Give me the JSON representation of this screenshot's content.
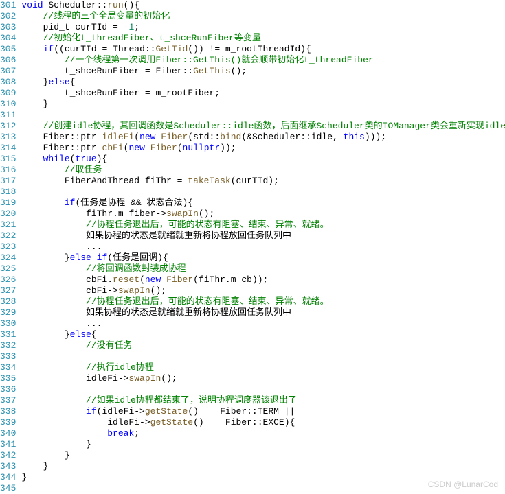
{
  "first_line": 301,
  "watermark": "CSDN @LunarCod",
  "lines": [
    [
      [
        "kw",
        "void"
      ],
      [
        "id",
        " Scheduler"
      ],
      [
        "op",
        "::"
      ],
      [
        "fn",
        "run"
      ],
      [
        "op",
        "(){"
      ]
    ],
    [
      [
        "id",
        "    "
      ],
      [
        "cmt",
        "//线程的三个全局变量的初始化"
      ]
    ],
    [
      [
        "id",
        "    pid_t curTId "
      ],
      [
        "op",
        "= "
      ],
      [
        "num",
        "-1"
      ],
      [
        "op",
        ";"
      ]
    ],
    [
      [
        "id",
        "    "
      ],
      [
        "cmt",
        "//初始化t_threadFiber、t_shceRunFiber等变量"
      ]
    ],
    [
      [
        "id",
        "    "
      ],
      [
        "kw",
        "if"
      ],
      [
        "op",
        "((curTId "
      ],
      [
        "op",
        "="
      ],
      [
        "id",
        " Thread"
      ],
      [
        "op",
        "::"
      ],
      [
        "fn",
        "GetTid"
      ],
      [
        "op",
        "()) "
      ],
      [
        "op",
        "!="
      ],
      [
        "id",
        " m_rootThreadId"
      ],
      [
        "op",
        "){"
      ]
    ],
    [
      [
        "id",
        "        "
      ],
      [
        "cmt",
        "//一个线程第一次调用Fiber::GetThis()就会顺带初始化t_threadFiber"
      ]
    ],
    [
      [
        "id",
        "        t_shceRunFiber "
      ],
      [
        "op",
        "="
      ],
      [
        "id",
        " Fiber"
      ],
      [
        "op",
        "::"
      ],
      [
        "fn",
        "GetThis"
      ],
      [
        "op",
        "();"
      ]
    ],
    [
      [
        "id",
        "    "
      ],
      [
        "op",
        "}"
      ],
      [
        "kw",
        "else"
      ],
      [
        "op",
        "{"
      ]
    ],
    [
      [
        "id",
        "        t_shceRunFiber "
      ],
      [
        "op",
        "="
      ],
      [
        "id",
        " m_rootFiber"
      ],
      [
        "op",
        ";"
      ]
    ],
    [
      [
        "id",
        "    "
      ],
      [
        "op",
        "}"
      ]
    ],
    [
      [
        "id",
        ""
      ]
    ],
    [
      [
        "id",
        "    "
      ],
      [
        "cmt",
        "//创建idle协程，其回调函数是Scheduler::idle函数，后面继承Scheduler类的IOManager类会重新实现idle函数"
      ]
    ],
    [
      [
        "id",
        "    Fiber"
      ],
      [
        "op",
        "::"
      ],
      [
        "id",
        "ptr "
      ],
      [
        "fn",
        "idleFi"
      ],
      [
        "op",
        "("
      ],
      [
        "kw",
        "new"
      ],
      [
        "id",
        " "
      ],
      [
        "fn",
        "Fiber"
      ],
      [
        "op",
        "(std"
      ],
      [
        "op",
        "::"
      ],
      [
        "fn",
        "bind"
      ],
      [
        "op",
        "("
      ],
      [
        "op",
        "&"
      ],
      [
        "id",
        "Scheduler"
      ],
      [
        "op",
        "::"
      ],
      [
        "id",
        "idle"
      ],
      [
        "op",
        ", "
      ],
      [
        "kw",
        "this"
      ],
      [
        "op",
        ")));"
      ]
    ],
    [
      [
        "id",
        "    Fiber"
      ],
      [
        "op",
        "::"
      ],
      [
        "id",
        "ptr "
      ],
      [
        "fn",
        "cbFi"
      ],
      [
        "op",
        "("
      ],
      [
        "kw",
        "new"
      ],
      [
        "id",
        " "
      ],
      [
        "fn",
        "Fiber"
      ],
      [
        "op",
        "("
      ],
      [
        "kw",
        "nullptr"
      ],
      [
        "op",
        "));"
      ]
    ],
    [
      [
        "id",
        "    "
      ],
      [
        "kw",
        "while"
      ],
      [
        "op",
        "("
      ],
      [
        "kw",
        "true"
      ],
      [
        "op",
        "){"
      ]
    ],
    [
      [
        "id",
        "        "
      ],
      [
        "cmt",
        "//取任务"
      ]
    ],
    [
      [
        "id",
        "        FiberAndThread fiThr "
      ],
      [
        "op",
        "="
      ],
      [
        "id",
        " "
      ],
      [
        "fn",
        "takeTask"
      ],
      [
        "op",
        "(curTId);"
      ]
    ],
    [
      [
        "id",
        ""
      ]
    ],
    [
      [
        "id",
        "        "
      ],
      [
        "kw",
        "if"
      ],
      [
        "op",
        "("
      ],
      [
        "id",
        "任务是协程 "
      ],
      [
        "op",
        "&&"
      ],
      [
        "id",
        " 状态合法"
      ],
      [
        "op",
        "){"
      ]
    ],
    [
      [
        "id",
        "            fiThr"
      ],
      [
        "op",
        "."
      ],
      [
        "id",
        "m_fiber"
      ],
      [
        "op",
        "->"
      ],
      [
        "fn",
        "swapIn"
      ],
      [
        "op",
        "();"
      ]
    ],
    [
      [
        "id",
        "            "
      ],
      [
        "cmt",
        "//协程任务退出后，可能的状态有阻塞、结束、异常、就绪。"
      ]
    ],
    [
      [
        "id",
        "            如果协程的状态是就绪就重新将协程放回任务队列中"
      ]
    ],
    [
      [
        "id",
        "            "
      ],
      [
        "op",
        "..."
      ]
    ],
    [
      [
        "id",
        "        "
      ],
      [
        "op",
        "}"
      ],
      [
        "kw",
        "else if"
      ],
      [
        "op",
        "("
      ],
      [
        "id",
        "任务是回调"
      ],
      [
        "op",
        "){"
      ]
    ],
    [
      [
        "id",
        "            "
      ],
      [
        "cmt",
        "//将回调函数封装成协程"
      ]
    ],
    [
      [
        "id",
        "            cbFi"
      ],
      [
        "op",
        "."
      ],
      [
        "fn",
        "reset"
      ],
      [
        "op",
        "("
      ],
      [
        "kw",
        "new"
      ],
      [
        "id",
        " "
      ],
      [
        "fn",
        "Fiber"
      ],
      [
        "op",
        "(fiThr"
      ],
      [
        "op",
        "."
      ],
      [
        "id",
        "m_cb"
      ],
      [
        "op",
        "));"
      ]
    ],
    [
      [
        "id",
        "            cbFi"
      ],
      [
        "op",
        "->"
      ],
      [
        "fn",
        "swapIn"
      ],
      [
        "op",
        "();"
      ]
    ],
    [
      [
        "id",
        "            "
      ],
      [
        "cmt",
        "//协程任务退出后，可能的状态有阻塞、结束、异常、就绪。"
      ]
    ],
    [
      [
        "id",
        "            如果协程的状态是就绪就重新将协程放回任务队列中"
      ]
    ],
    [
      [
        "id",
        "            "
      ],
      [
        "op",
        "..."
      ]
    ],
    [
      [
        "id",
        "        "
      ],
      [
        "op",
        "}"
      ],
      [
        "kw",
        "else"
      ],
      [
        "op",
        "{"
      ]
    ],
    [
      [
        "id",
        "            "
      ],
      [
        "cmt",
        "//没有任务"
      ]
    ],
    [
      [
        "id",
        ""
      ]
    ],
    [
      [
        "id",
        "            "
      ],
      [
        "cmt",
        "//执行idle协程"
      ]
    ],
    [
      [
        "id",
        "            idleFi"
      ],
      [
        "op",
        "->"
      ],
      [
        "fn",
        "swapIn"
      ],
      [
        "op",
        "();"
      ]
    ],
    [
      [
        "id",
        ""
      ]
    ],
    [
      [
        "id",
        "            "
      ],
      [
        "cmt",
        "//如果idle协程都结束了，说明协程调度器该退出了"
      ]
    ],
    [
      [
        "id",
        "            "
      ],
      [
        "kw",
        "if"
      ],
      [
        "op",
        "(idleFi"
      ],
      [
        "op",
        "->"
      ],
      [
        "fn",
        "getState"
      ],
      [
        "op",
        "() "
      ],
      [
        "op",
        "=="
      ],
      [
        "id",
        " Fiber"
      ],
      [
        "op",
        "::"
      ],
      [
        "id",
        "TERM "
      ],
      [
        "op",
        "||"
      ]
    ],
    [
      [
        "id",
        "                idleFi"
      ],
      [
        "op",
        "->"
      ],
      [
        "fn",
        "getState"
      ],
      [
        "op",
        "() "
      ],
      [
        "op",
        "=="
      ],
      [
        "id",
        " Fiber"
      ],
      [
        "op",
        "::"
      ],
      [
        "id",
        "EXCE"
      ],
      [
        "op",
        "){"
      ]
    ],
    [
      [
        "id",
        "                "
      ],
      [
        "kw",
        "break"
      ],
      [
        "op",
        ";"
      ]
    ],
    [
      [
        "id",
        "            "
      ],
      [
        "op",
        "}"
      ]
    ],
    [
      [
        "id",
        "        "
      ],
      [
        "op",
        "}"
      ]
    ],
    [
      [
        "id",
        "    "
      ],
      [
        "op",
        "}"
      ]
    ],
    [
      [
        "op",
        "}"
      ]
    ],
    [
      [
        "id",
        ""
      ]
    ]
  ]
}
